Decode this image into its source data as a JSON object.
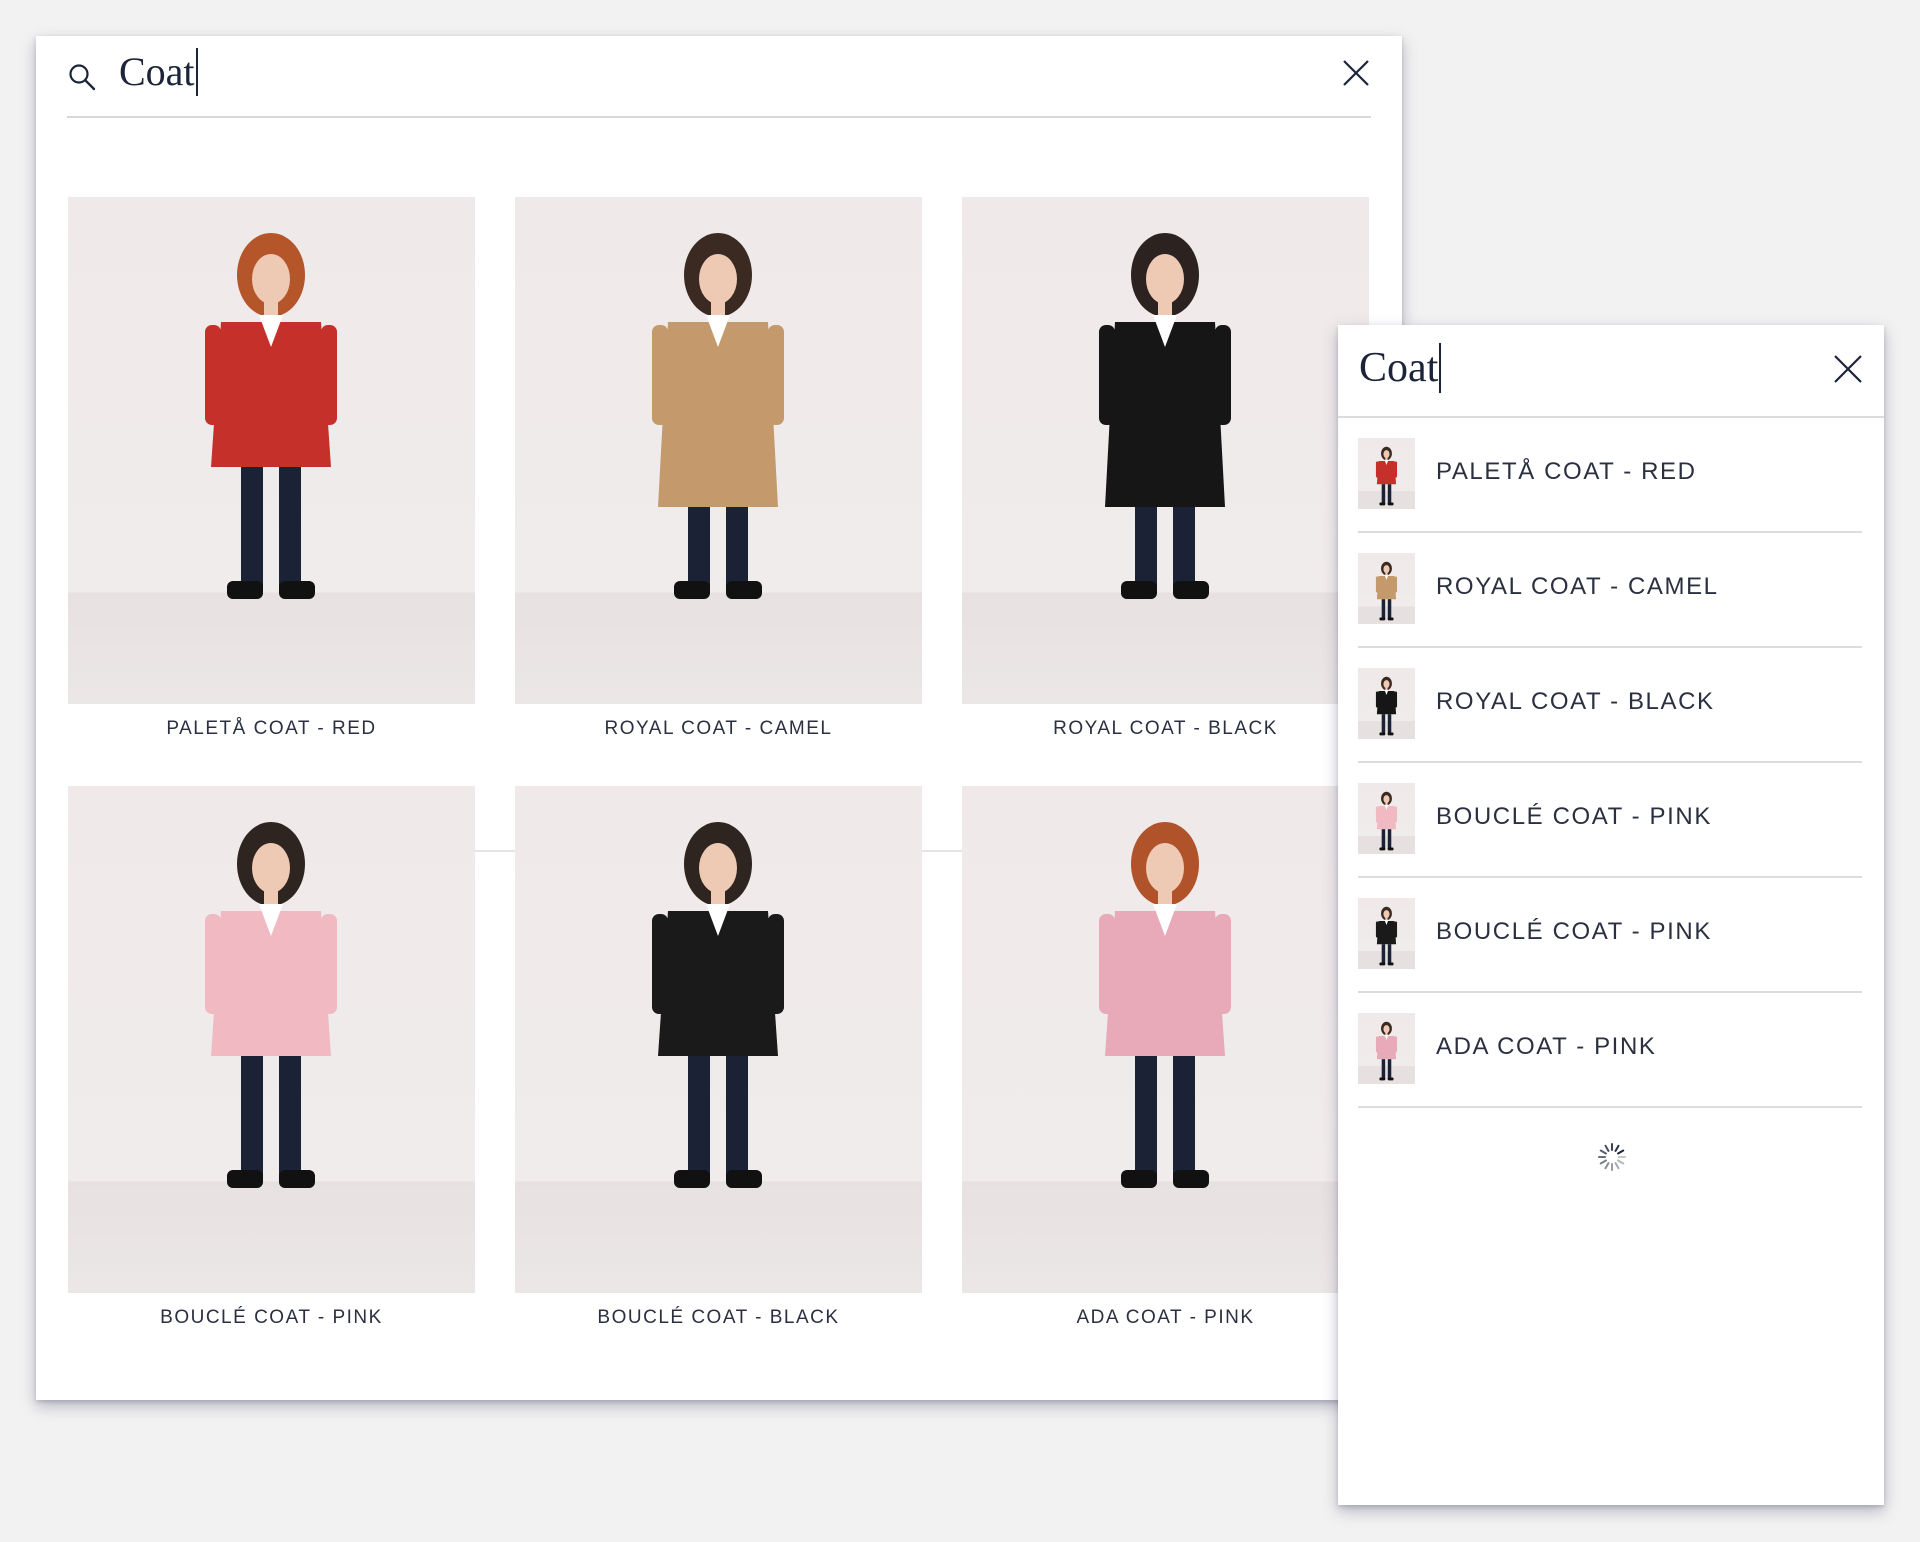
{
  "desktop": {
    "search": {
      "query": "Coat",
      "search_icon": "search-icon",
      "close_icon": "close-icon"
    },
    "products": [
      {
        "name": "PALETÅ COAT - RED",
        "coat_color": "#c5302a",
        "hair": "#b5552a",
        "style": "short"
      },
      {
        "name": "ROYAL COAT - CAMEL",
        "coat_color": "#c49a6c",
        "hair": "#3a2a22",
        "style": "long"
      },
      {
        "name": "ROYAL COAT - BLACK",
        "coat_color": "#161616",
        "hair": "#2c2220",
        "style": "long"
      },
      {
        "name": "BOUCLÉ COAT - PINK",
        "coat_color": "#f1b9c2",
        "hair": "#2e2420",
        "style": "short"
      },
      {
        "name": "BOUCLÉ COAT - BLACK",
        "coat_color": "#1a1a1a",
        "hair": "#2e2420",
        "style": "short"
      },
      {
        "name": "ADA COAT - PINK",
        "coat_color": "#e8a9b8",
        "hair": "#b0532a",
        "style": "short"
      }
    ]
  },
  "mobile": {
    "search": {
      "query": "Coat",
      "close_icon": "close-icon"
    },
    "results": [
      {
        "name": "PALETÅ COAT - RED",
        "coat_color": "#c5302a"
      },
      {
        "name": "ROYAL COAT - CAMEL",
        "coat_color": "#c49a6c"
      },
      {
        "name": "ROYAL COAT - BLACK",
        "coat_color": "#161616"
      },
      {
        "name": "BOUCLÉ COAT - PINK",
        "coat_color": "#f1b9c2"
      },
      {
        "name": "BOUCLÉ COAT - PINK",
        "coat_color": "#1a1a1a"
      },
      {
        "name": "ADA COAT - PINK",
        "coat_color": "#e8a9b8"
      }
    ],
    "loading_icon": "loading-spinner-icon"
  },
  "colors": {
    "text": "#2b3040",
    "query_text": "#1b2438",
    "divider": "#dcdcdc",
    "background": "#f2f2f2"
  }
}
